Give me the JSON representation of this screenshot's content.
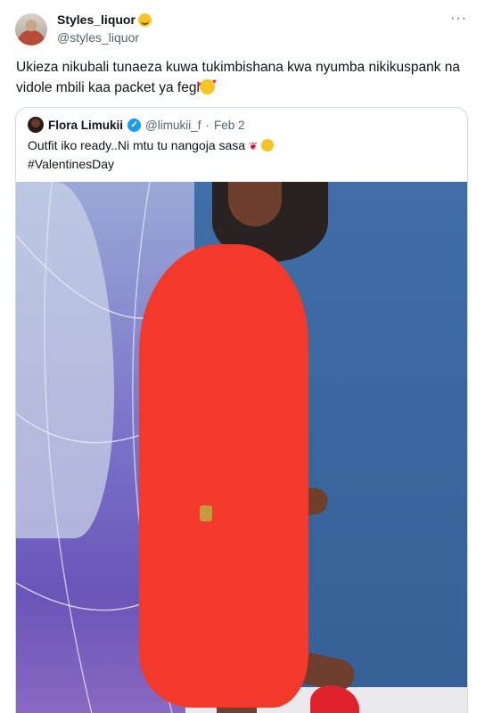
{
  "tweet": {
    "display_name": "Styles_liquor",
    "handle": "@styles_liquor",
    "more_label": "···",
    "text": "Ukieza nikubali tunaeza kuwa tukimbishana kwa nyumba nikikuspank na vidole mbili kaa packet ya fegi"
  },
  "quoted": {
    "display_name": "Flora Limukii",
    "handle": "@limukii_f",
    "separator": "·",
    "date": "Feb 2",
    "verified_mark": "✓",
    "line1": "Outfit iko ready..Ni mtu tu nangoja sasa",
    "line2": "#ValentinesDay",
    "rose_icon": "❦"
  },
  "icons": {
    "author_emoji": "slightly-smiling-face-icon",
    "text_emoji": "smiling-face-with-hearts-icon",
    "rose": "rose-icon",
    "wink": "winking-face-icon"
  },
  "colors": {
    "verified": "#1d9bf0",
    "secondary_text": "#536471",
    "border": "#cfd9de",
    "dress": "#f2392a"
  }
}
